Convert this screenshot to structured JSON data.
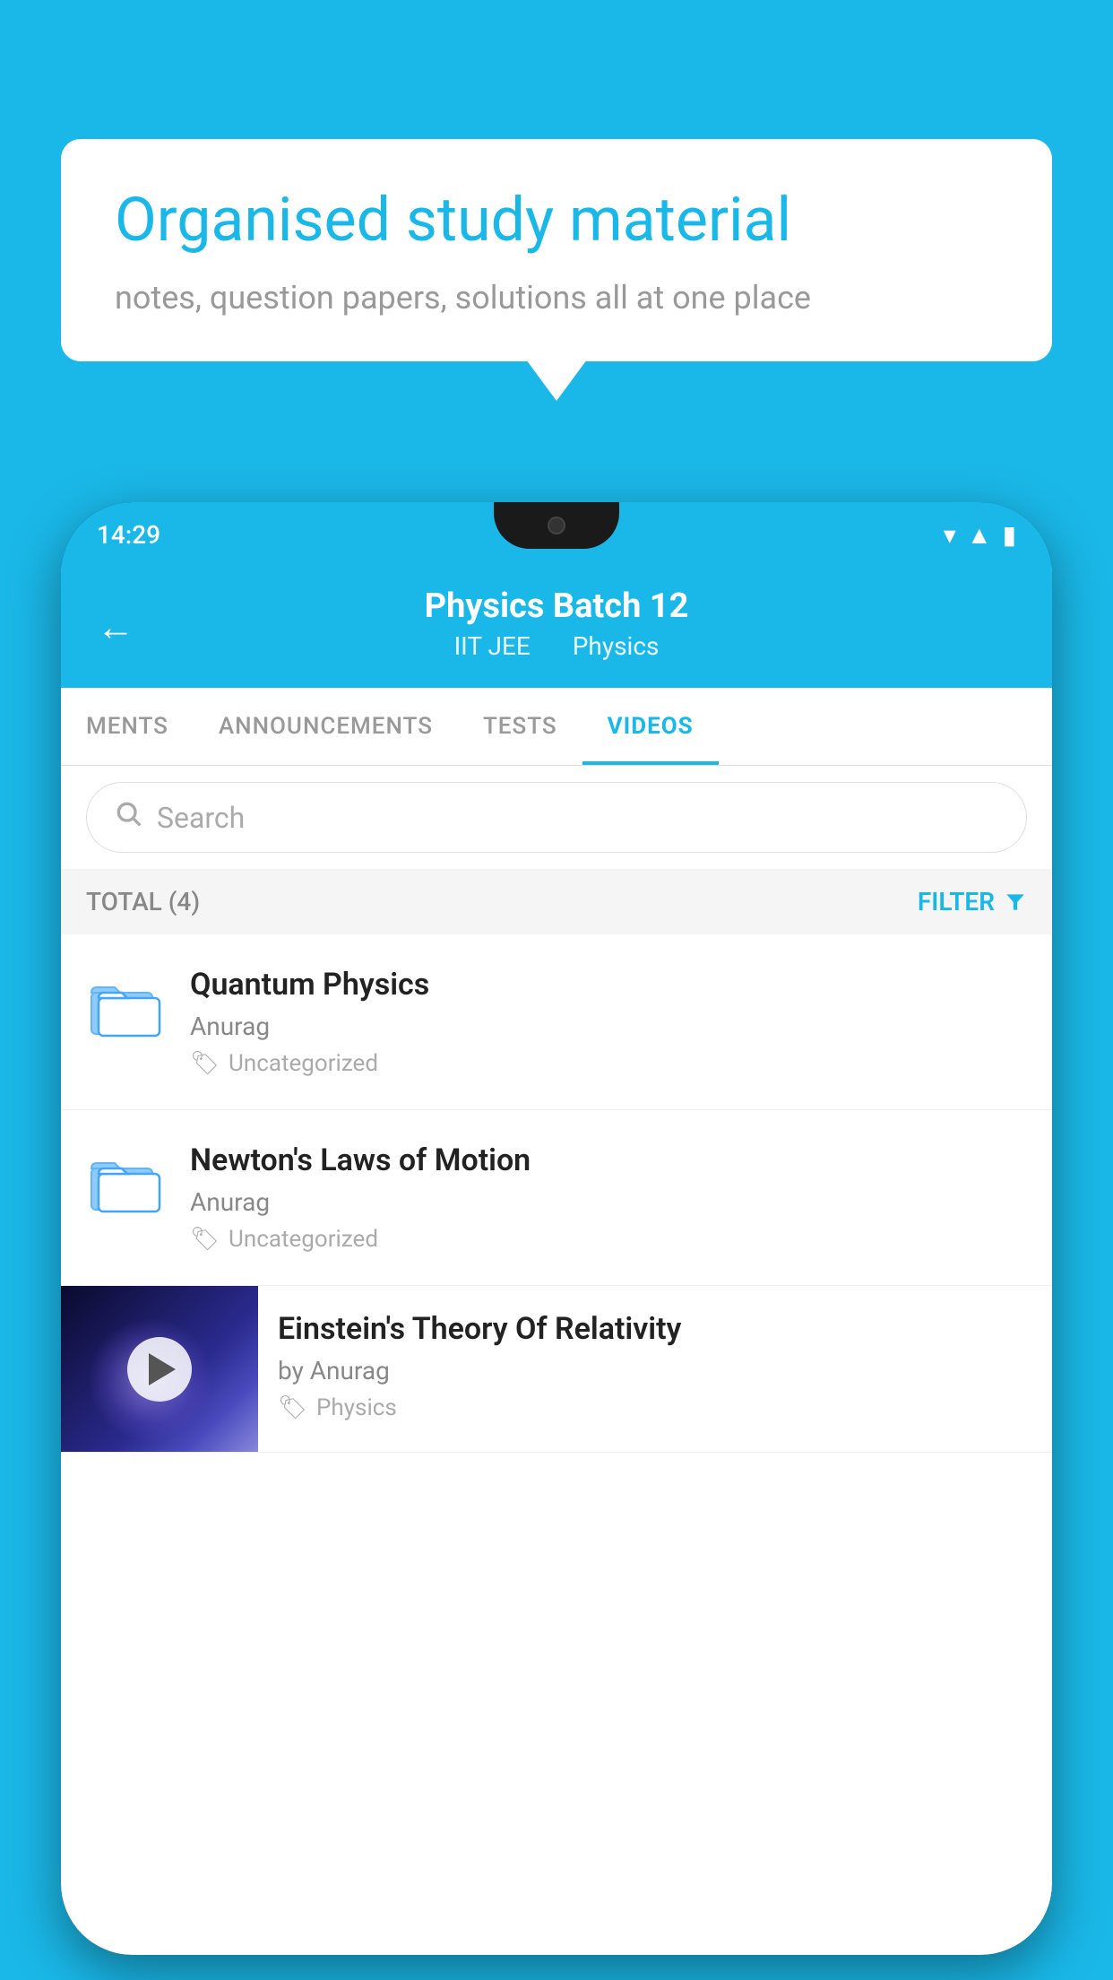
{
  "background_color": "#1ab8e8",
  "speech_bubble": {
    "headline": "Organised study material",
    "subtext": "notes, question papers, solutions all at one place"
  },
  "phone": {
    "status_bar": {
      "time": "14:29"
    },
    "app_header": {
      "title": "Physics Batch 12",
      "subtitle_part1": "IIT JEE",
      "subtitle_part2": "Physics",
      "back_label": "←"
    },
    "tabs": [
      {
        "label": "MENTS",
        "active": false
      },
      {
        "label": "ANNOUNCEMENTS",
        "active": false
      },
      {
        "label": "TESTS",
        "active": false
      },
      {
        "label": "VIDEOS",
        "active": true
      }
    ],
    "search": {
      "placeholder": "Search"
    },
    "filter_row": {
      "total_label": "TOTAL (4)",
      "filter_label": "FILTER"
    },
    "list_items": [
      {
        "title": "Quantum Physics",
        "author": "Anurag",
        "tag": "Uncategorized",
        "type": "folder"
      },
      {
        "title": "Newton's Laws of Motion",
        "author": "Anurag",
        "tag": "Uncategorized",
        "type": "folder"
      },
      {
        "title": "Einstein's Theory Of Relativity",
        "author": "by Anurag",
        "tag": "Physics",
        "type": "video"
      }
    ]
  }
}
